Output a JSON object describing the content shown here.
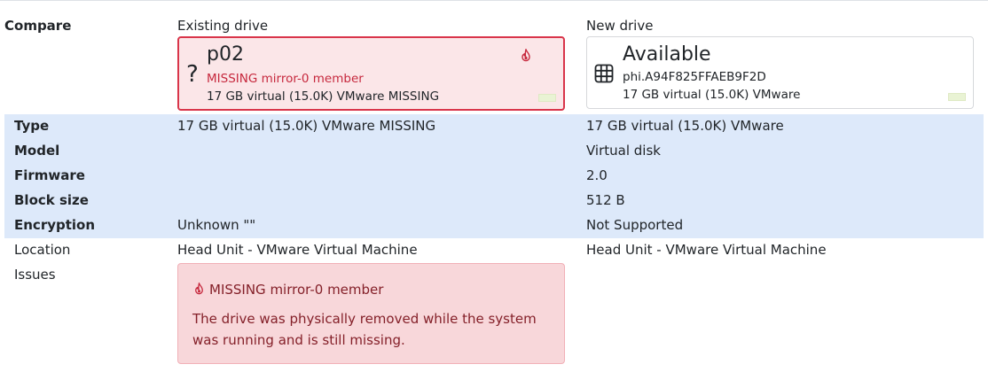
{
  "compare_label": "Compare",
  "existing": {
    "heading": "Existing drive",
    "glyph": "?",
    "name": "p02",
    "status": "MISSING mirror-0 member",
    "info": "17 GB virtual (15.0K) VMware MISSING",
    "icon": "fire-icon",
    "accent": "#d9354a"
  },
  "new": {
    "heading": "New drive",
    "name": "Available",
    "serial": "phi.A94F825FFAEB9F2D",
    "info": "17 GB virtual (15.0K) VMware",
    "icon": "grid-icon"
  },
  "rows": [
    {
      "label": "Type",
      "existing": "17 GB virtual (15.0K) VMware MISSING",
      "new": "17 GB virtual (15.0K) VMware"
    },
    {
      "label": "Model",
      "existing": "",
      "new": "Virtual disk"
    },
    {
      "label": "Firmware",
      "existing": "",
      "new": "2.0"
    },
    {
      "label": "Block size",
      "existing": "",
      "new": "512 B"
    },
    {
      "label": "Encryption",
      "existing": "Unknown \"\"",
      "new": "Not Supported"
    },
    {
      "label": "Location",
      "existing": "Head Unit - VMware Virtual Machine",
      "new": "Head Unit - VMware Virtual Machine"
    },
    {
      "label": "Issues",
      "existing": "",
      "new": ""
    }
  ],
  "issue": {
    "title": "MISSING mirror-0 member",
    "body": "The drive was physically removed while the system was running and is still missing."
  }
}
